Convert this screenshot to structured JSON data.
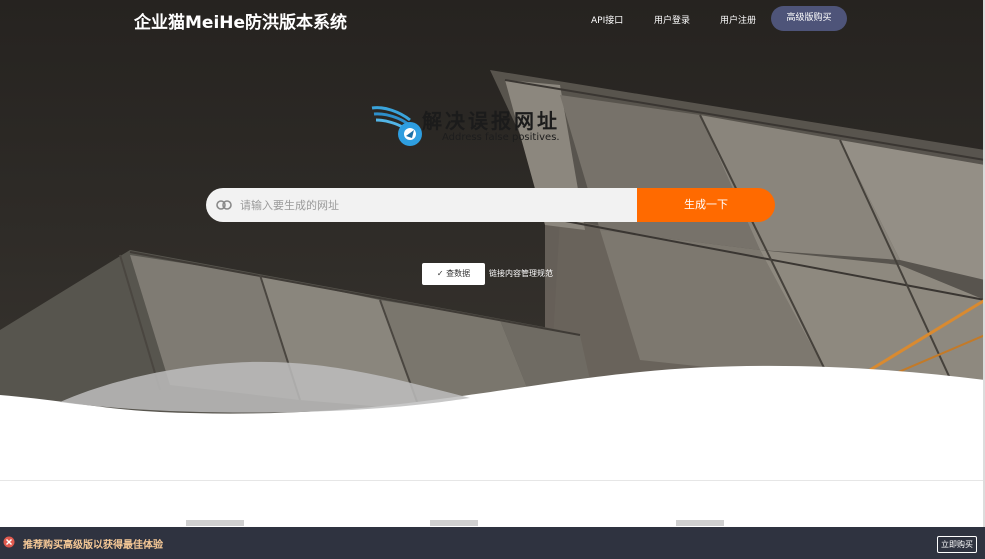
{
  "header": {
    "brand": "企业猫MeiHe防洪版本系统",
    "nav": {
      "api": "API接口",
      "login": "用户登录",
      "register": "用户注册",
      "buy": "高级版购买"
    }
  },
  "watermark": {
    "title": "解决误报网址",
    "subtitle": "Address false positives."
  },
  "search": {
    "placeholder": "请输入要生成的网址",
    "button": "生成一下"
  },
  "agreement": {
    "check_label": "✓ 查数据",
    "link": "链接内容管理规范"
  },
  "bottom_bar": {
    "message": "推荐购买高级版以获得最佳体验",
    "buy_button": "立即购买"
  },
  "colors": {
    "accent": "#ff6a00",
    "nav_buy": "#4e5479",
    "bottom_bar": "#2f3340",
    "bottom_text": "#f5c896"
  },
  "icons": {
    "search": "link-icon",
    "close": "close-icon",
    "logo": "bird-logo-icon"
  }
}
